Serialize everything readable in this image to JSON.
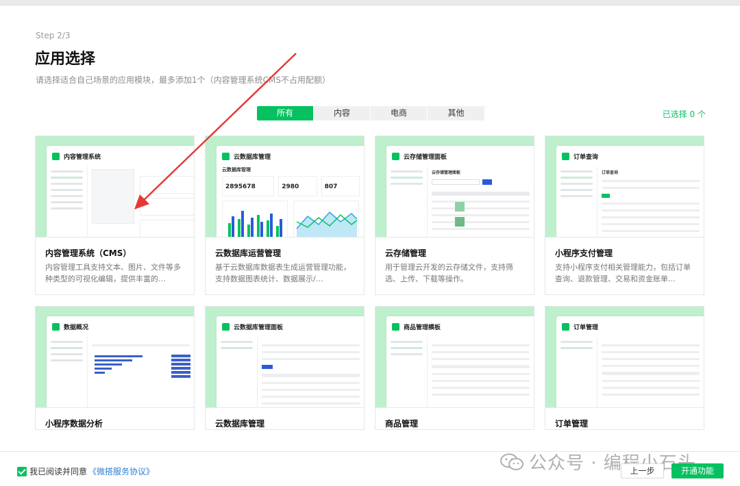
{
  "header": {
    "step": "Step 2/3",
    "title": "应用选择",
    "subtitle": "请选择适合自己场景的应用模块，最多添加1个（内容管理系统CMS不占用配额）"
  },
  "tabs": [
    {
      "label": "所有",
      "active": true
    },
    {
      "label": "内容",
      "active": false
    },
    {
      "label": "电商",
      "active": false
    },
    {
      "label": "其他",
      "active": false
    }
  ],
  "selected_count": "已选择 0 个",
  "cards": [
    {
      "preview_title": "内容管理系统",
      "title": "内容管理系统（CMS）",
      "desc": "内容管理工具支持文本、图片、文件等多种类型的可视化编辑，提供丰富的…"
    },
    {
      "preview_title": "云数据库管理",
      "title": "云数据库运营管理",
      "desc": "基于云数据库数据表生成运营管理功能，支持数据图表统计、数据展示/…"
    },
    {
      "preview_title": "云存储管理面板",
      "title": "云存储管理",
      "desc": "用于管理云开发的云存储文件，支持筛选、上传、下载等操作。"
    },
    {
      "preview_title": "订单查询",
      "title": "小程序支付管理",
      "desc": "支持小程序支付相关管理能力，包括订单查询、退款管理、交易和资金账单…"
    },
    {
      "preview_title": "数据概况",
      "title": "小程序数据分析",
      "desc": ""
    },
    {
      "preview_title": "云数据库管理面板",
      "title": "云数据库管理",
      "desc": ""
    },
    {
      "preview_title": "商品管理模板",
      "title": "商品管理",
      "desc": ""
    },
    {
      "preview_title": "订单管理",
      "title": "订单管理",
      "desc": ""
    }
  ],
  "preview_text": {
    "card2_heading": "云数据库管理",
    "card2_stats": [
      "2895678",
      "2980",
      "807"
    ],
    "card3_heading": "云存储管理面板",
    "card4_heading": "订单查询"
  },
  "footer": {
    "agree_text": "我已阅读并同意",
    "agreement_link": "《微搭服务协议》",
    "watermark": "公众号 · 编程小石头",
    "prev_button": "上一步",
    "next_button": "开通功能"
  },
  "colors": {
    "accent": "#07c160",
    "preview_bg": "#bff0cd",
    "link": "#2a7fd4",
    "arrow": "#e53935"
  },
  "icons": [
    "checkbox-checked-icon",
    "wechat-icon",
    "app-logo-icon"
  ]
}
